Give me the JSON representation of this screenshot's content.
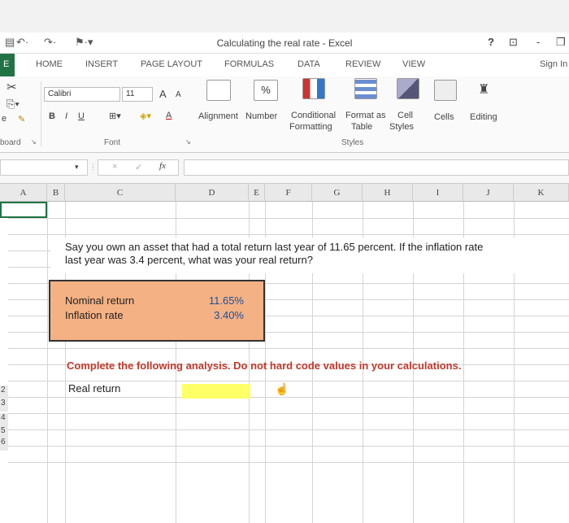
{
  "window": {
    "title": "Calculating the real rate - Excel",
    "help": "?",
    "minimize": "-"
  },
  "tabs": [
    "HOME",
    "INSERT",
    "PAGE LAYOUT",
    "FORMULAS",
    "DATA",
    "REVIEW",
    "VIEW"
  ],
  "file_tab": "E",
  "sign_in": "Sign In",
  "ribbon": {
    "font_name": "Calibri",
    "font_size": "11",
    "font_grow": "A",
    "font_shrink": "A",
    "bold": "B",
    "italic": "I",
    "underline": "U",
    "font_color": "A",
    "alignment": "Alignment",
    "number": "Number",
    "percent": "%",
    "conditional_formatting": [
      "Conditional",
      "Formatting"
    ],
    "format_as_table": [
      "Format as",
      "Table"
    ],
    "cell_styles": [
      "Cell",
      "Styles"
    ],
    "cells": "Cells",
    "editing": "Editing",
    "groups": {
      "clipboard": "board",
      "font": "Font",
      "styles": "Styles"
    },
    "paste_partial": "e"
  },
  "formula_bar": {
    "fx": "fx",
    "cancel": "×",
    "enter": "✓"
  },
  "columns": [
    "A",
    "B",
    "C",
    "D",
    "E",
    "F",
    "G",
    "H",
    "I",
    "J",
    "K"
  ],
  "rows": [
    "2",
    "3",
    "4",
    "5",
    "6"
  ],
  "sheet": {
    "question_line1": "Say you own an asset that had a total return last year of 11.65 percent. If the inflation rate",
    "question_line2": "last year was 3.4 percent, what was your real return?",
    "inputs": [
      {
        "label": "Nominal return",
        "value": "11.65%"
      },
      {
        "label": "Inflation rate",
        "value": "3.40%"
      }
    ],
    "instruction": "Complete the following analysis. Do not hard code values in your calculations.",
    "result_label": "Real return"
  },
  "colors": {
    "excel_green": "#217346",
    "input_fill": "#f4b183",
    "instruction_red": "#c0392b",
    "highlight": "#ffff66"
  }
}
